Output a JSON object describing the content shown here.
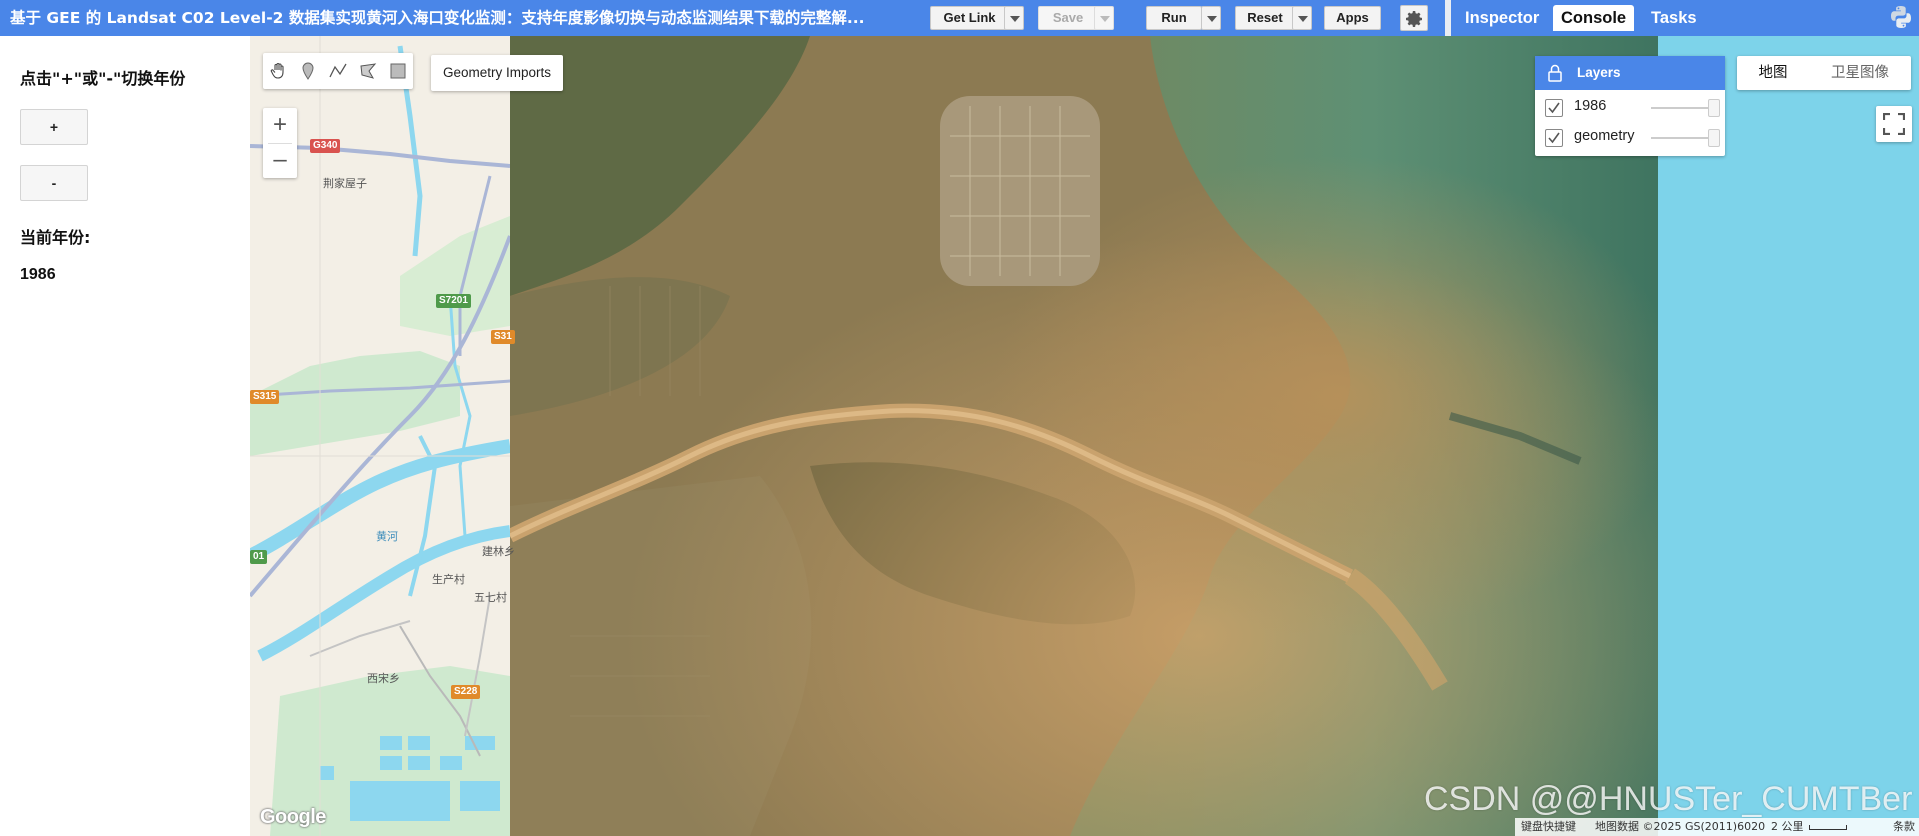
{
  "topbar": {
    "title": "基于 GEE 的 Landsat C02 Level-2 数据集实现黄河入海口变化监测：支持年度影像切换与动态监测结果下载的完整解...",
    "get_link": "Get Link",
    "save": "Save",
    "run": "Run",
    "reset": "Reset",
    "apps": "Apps",
    "tabs": [
      "Inspector",
      "Console",
      "Tasks"
    ],
    "active_tab": "Console"
  },
  "left_panel": {
    "instruction": "点击\"+\"或\"-\"切换年份",
    "plus_button": "+",
    "minus_button": "-",
    "current_year_label": "当前年份:",
    "current_year": "1986"
  },
  "map": {
    "geometry_imports": "Geometry Imports",
    "zoom_in": "+",
    "zoom_out": "–",
    "layers": {
      "title": "Layers",
      "items": [
        {
          "name": "1986",
          "checked": true
        },
        {
          "name": "geometry",
          "checked": true
        }
      ]
    },
    "map_type": {
      "map": "地图",
      "satellite": "卫星图像",
      "selected": "地图"
    },
    "labels": {
      "place1": "荆家屋子",
      "place2": "建林乡",
      "place3": "生产村",
      "place4": "五七村",
      "place5": "西宋乡",
      "river": "黄河"
    },
    "road_shields": {
      "g340": "G340",
      "s7201": "S7201",
      "s31": "S31",
      "s315": "S315",
      "s01": "01",
      "s228": "S228"
    },
    "google_logo": "Google",
    "bottom": {
      "shortcuts": "键盘快捷键",
      "map_data": "地图数据 ©2025 GS(2011)6020",
      "scale": "2 公里",
      "terms": "条款"
    },
    "watermark": "CSDN @@HNUSTer_CUMTBer"
  },
  "colors": {
    "accent_blue": "#4a86e8",
    "water": "#8dd7ef",
    "sea": "#5aa3a0"
  }
}
